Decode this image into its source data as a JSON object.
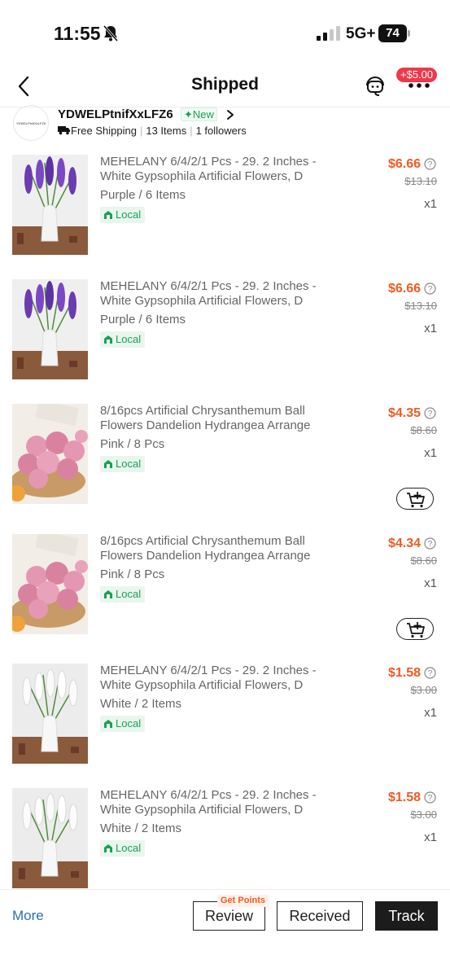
{
  "status_bar": {
    "time": "11:55",
    "network": "5G+",
    "battery": "74",
    "icons": [
      "bell-slash-icon",
      "signal-icon"
    ]
  },
  "header": {
    "title": "Shipped",
    "promo_badge": "+$5.00",
    "icons": [
      "back-arrow-icon",
      "customer-support-icon",
      "more-dots-icon"
    ]
  },
  "store": {
    "logo_text": "YDWELPtnifXxLFZ6",
    "name": "YDWELPtnifXxLFZ6",
    "new_badge": "New",
    "shipping": "Free Shipping",
    "items_count": "13 Items",
    "followers": "1 followers"
  },
  "items": [
    {
      "title": "MEHELANY 6/4/2/1 Pcs - 29. 2 Inches - White Gypsophila Artificial Flowers, D",
      "variant": "Purple / 6 Items",
      "tag": "Local",
      "price": "$6.66",
      "original_price": "$13.10",
      "quantity": "x1",
      "image": "purple-lavender-vase",
      "add_to_cart": false
    },
    {
      "title": "MEHELANY 6/4/2/1 Pcs - 29. 2 Inches - White Gypsophila Artificial Flowers, D",
      "variant": "Purple / 6 Items",
      "tag": "Local",
      "price": "$6.66",
      "original_price": "$13.10",
      "quantity": "x1",
      "image": "purple-lavender-vase",
      "add_to_cart": false
    },
    {
      "title": "8/16pcs Artificial Chrysanthemum Ball Flowers Dandelion Hydrangea Arrange",
      "variant": "Pink / 8 Pcs",
      "tag": "Local",
      "price": "$4.35",
      "original_price": "$8.60",
      "quantity": "x1",
      "image": "pink-chrysanthemum-balls",
      "add_to_cart": true
    },
    {
      "title": "8/16pcs Artificial Chrysanthemum Ball Flowers Dandelion Hydrangea Arrange",
      "variant": "Pink / 8 Pcs",
      "tag": "Local",
      "price": "$4.34",
      "original_price": "$8.60",
      "quantity": "x1",
      "image": "pink-chrysanthemum-balls",
      "add_to_cart": true
    },
    {
      "title": "MEHELANY 6/4/2/1 Pcs - 29. 2 Inches - White Gypsophila Artificial Flowers, D",
      "variant": "White / 2 Items",
      "tag": "Local",
      "price": "$1.58",
      "original_price": "$3.00",
      "quantity": "x1",
      "image": "white-lavender-vase",
      "add_to_cart": false
    },
    {
      "title": "MEHELANY 6/4/2/1 Pcs - 29. 2 Inches - White Gypsophila Artificial Flowers, D",
      "variant": "White / 2 Items",
      "tag": "Local",
      "price": "$1.58",
      "original_price": "$3.00",
      "quantity": "x1",
      "image": "white-lavender-vase",
      "add_to_cart": false
    }
  ],
  "bottom_bar": {
    "more": "More",
    "points_badge": "Get Points",
    "review": "Review",
    "received": "Received",
    "track": "Track"
  },
  "colors": {
    "price": "#f05a23",
    "local_tag": "#1a9f55",
    "promo_badge": "#f0384b",
    "more_link": "#2d6fb0",
    "track_button": "#1c1c1c"
  }
}
